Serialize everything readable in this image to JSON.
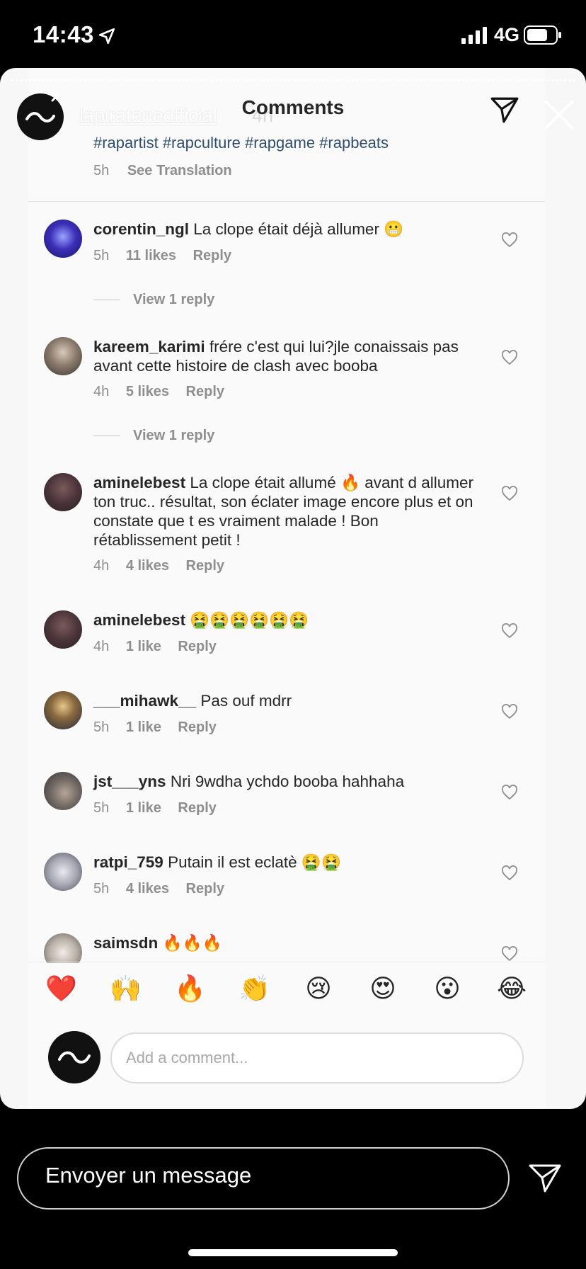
{
  "status": {
    "time": "14:43",
    "network": "4G"
  },
  "header": {
    "story_user": "lapiraterieofficial",
    "story_age": "4h",
    "title": "Comments"
  },
  "caption": {
    "hashtags": "#rapartist #rapculture #rapgame #rapbeats",
    "age": "5h",
    "see_translation": "See Translation"
  },
  "comments": [
    {
      "user": "corentin_ngl",
      "text": "La clope était déjà allumer 😬",
      "age": "5h",
      "likes": "11 likes",
      "reply": "Reply",
      "view_replies": "View 1 reply"
    },
    {
      "user": "kareem_karimi",
      "text": "frére c'est qui lui?jle conaissais pas avant cette histoire de clash avec booba",
      "age": "4h",
      "likes": "5 likes",
      "reply": "Reply",
      "view_replies": "View 1 reply"
    },
    {
      "user": "aminelebest",
      "text": "La clope était allumé 🔥 avant d allumer ton truc.. résultat, son éclater image encore plus et on constate que t es vraiment malade ! Bon rétablissement petit !",
      "age": "4h",
      "likes": "4 likes",
      "reply": "Reply"
    },
    {
      "user": "aminelebest",
      "text": "🤮🤮🤮🤮🤮🤮",
      "age": "4h",
      "likes": "1 like",
      "reply": "Reply"
    },
    {
      "user": "___mihawk__",
      "text": "Pas ouf mdrr",
      "age": "5h",
      "likes": "1 like",
      "reply": "Reply"
    },
    {
      "user": "jst___yns",
      "text": "Nri 9wdha ychdo booba hahhaha",
      "age": "5h",
      "likes": "1 like",
      "reply": "Reply"
    },
    {
      "user": "ratpi_759",
      "text": "Putain il est eclatè 🤮🤮",
      "age": "5h",
      "likes": "4 likes",
      "reply": "Reply"
    },
    {
      "user": "saimsdn",
      "text": "🔥🔥🔥"
    }
  ],
  "quick_reactions": [
    "❤️",
    "🙌",
    "🔥",
    "👏",
    "😢",
    "😍",
    "😮",
    "😂"
  ],
  "composer": {
    "placeholder": "Add a comment..."
  },
  "direct": {
    "placeholder": "Envoyer un message"
  },
  "icons": {
    "location": "location-arrow-icon",
    "signal": "signal-icon",
    "battery": "battery-icon",
    "send": "send-icon",
    "close": "close-icon",
    "heart": "heart-outline-icon"
  },
  "colors": {
    "hashtag": "#2f4e6f",
    "secondary_text": "#8e8e8e",
    "background": "#000000"
  }
}
